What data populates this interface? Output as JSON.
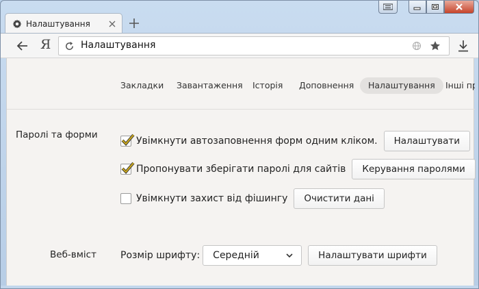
{
  "tab": {
    "title": "Налаштування",
    "icon": "gear-icon"
  },
  "toolbar": {
    "logo": "Я",
    "address": "Налаштування"
  },
  "nav": {
    "items": [
      {
        "label": "Закладки",
        "active": false
      },
      {
        "label": "Завантаження",
        "active": false
      },
      {
        "label": "Історія",
        "active": false
      },
      {
        "label": "Доповнення",
        "active": false
      },
      {
        "label": "Налаштування",
        "active": true
      },
      {
        "label": "Інші пр",
        "active": false
      }
    ]
  },
  "passwords": {
    "heading": "Паролі та форми",
    "autofill": {
      "label": "Увімкнути автозаповнення форм одним кліком.",
      "checked": true,
      "button": "Налаштувати"
    },
    "save_passwords": {
      "label": "Пропонувати зберігати паролі для сайтів",
      "checked": true,
      "button": "Керування паролями"
    },
    "phishing": {
      "label": "Увімкнути захист від фішингу",
      "checked": false,
      "button": "Очистити дані"
    }
  },
  "web_content": {
    "heading": "Веб-вміст",
    "font_size_label": "Розмір шрифту:",
    "font_size_value": "Середній",
    "fonts_button": "Налаштувати шрифти"
  },
  "colors": {
    "checkmark": "#c8a51e",
    "window_frame": "#b9d1ea",
    "close_button": "#c7442b"
  }
}
